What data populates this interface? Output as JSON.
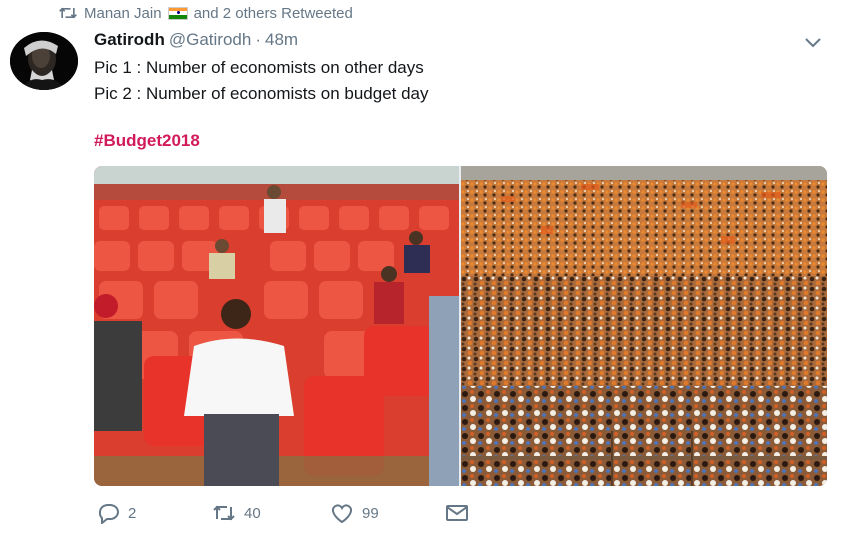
{
  "retweet_context": {
    "icon": "retweet-icon",
    "name": "Manan Jain",
    "flag": "india-flag-icon",
    "suffix": "and 2 others Retweeted"
  },
  "tweet": {
    "author_name": "Gatirodh",
    "author_handle": "@Gatirodh",
    "separator": "·",
    "timestamp": "48m",
    "lines": [
      "Pic 1 : Number of economists on other days",
      "Pic 2 : Number of economists on budget day"
    ],
    "hashtag": "#Budget2018",
    "hashtag_color": "#d2195a"
  },
  "media": {
    "images": [
      {
        "name": "empty-red-chairs-photo"
      },
      {
        "name": "large-crowd-photo"
      }
    ]
  },
  "actions": {
    "reply": {
      "icon": "reply-icon",
      "count": "2"
    },
    "retweet": {
      "icon": "retweet-icon",
      "count": "40"
    },
    "like": {
      "icon": "heart-icon",
      "count": "99"
    },
    "message": {
      "icon": "envelope-icon"
    }
  }
}
